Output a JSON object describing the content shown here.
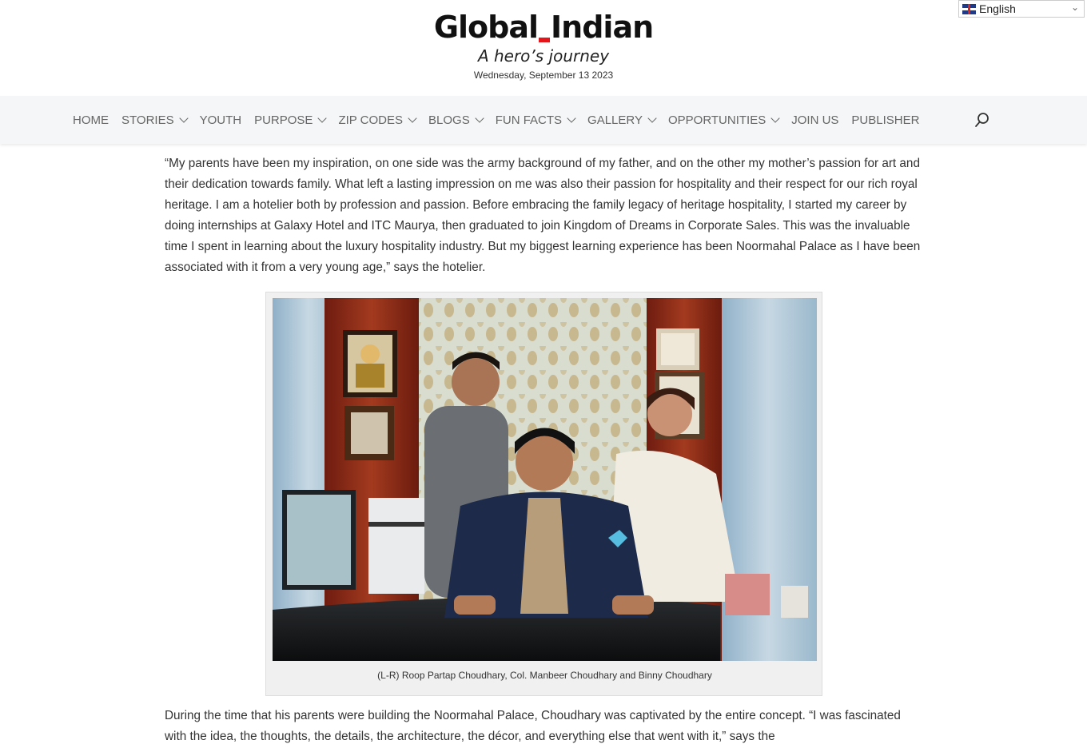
{
  "header": {
    "logo_left": "Global",
    "logo_right": "Indian",
    "tagline": "A hero’s journey",
    "date": "Wednesday, September 13 2023",
    "language": "English"
  },
  "nav": {
    "items": [
      {
        "label": "HOME",
        "has_dropdown": false
      },
      {
        "label": "STORIES",
        "has_dropdown": true
      },
      {
        "label": "YOUTH",
        "has_dropdown": false
      },
      {
        "label": "PURPOSE",
        "has_dropdown": true
      },
      {
        "label": "ZIP CODES",
        "has_dropdown": true
      },
      {
        "label": "BLOGS",
        "has_dropdown": true
      },
      {
        "label": "FUN FACTS",
        "has_dropdown": true
      },
      {
        "label": "GALLERY",
        "has_dropdown": true
      },
      {
        "label": "OPPORTUNITIES",
        "has_dropdown": true
      },
      {
        "label": "JOIN US",
        "has_dropdown": false
      },
      {
        "label": "PUBLISHER",
        "has_dropdown": false
      }
    ],
    "search_icon": "search-icon"
  },
  "article": {
    "paragraph_1": "“My parents have been my inspiration, on one side was the army background of my father, and on the other my mother’s passion for art and their dedication towards family. What left a lasting impression on me was also their passion for hospitality and their respect for our rich royal heritage. I am a hotelier both by profession and passion. Before embracing the family legacy of heritage hospitality, I started my career by doing internships at Galaxy Hotel and ITC Maurya, then graduated to join Kingdom of Dreams in Corporate Sales. This was the invaluable time I spent in learning about the luxury hospitality industry. But my biggest learning experience has been Noormahal Palace as I have been associated with it from a very young age,” says the hotelier.",
    "caption": "(L-R) Roop Partap Choudhary, Col. Manbeer Choudhary and Binny Choudhary",
    "paragraph_2": "During the time that his parents were building the Noormahal Palace, Choudhary was captivated by the entire concept. “I was fascinated with the idea, the thoughts, the details, the architecture, the décor, and everything else that went with it,” says the"
  },
  "colors": {
    "accent": "#e4161b",
    "nav_bg": "#f5f6f7",
    "nav_text": "#666666",
    "body_text": "#333333"
  }
}
